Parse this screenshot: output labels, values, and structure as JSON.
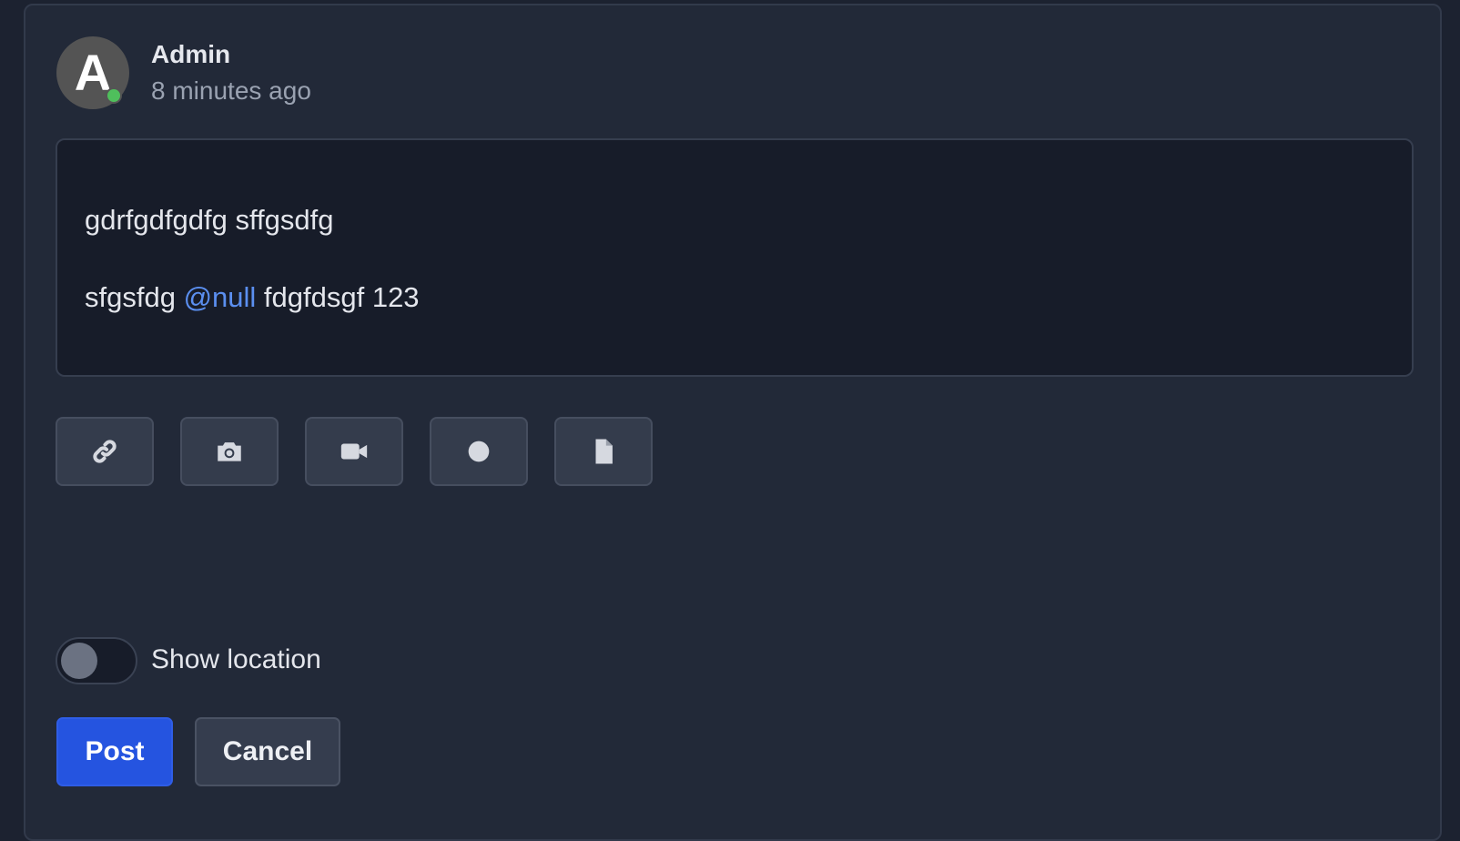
{
  "post": {
    "author": "Admin",
    "avatar_letter": "A",
    "timestamp": "8 minutes ago",
    "status": "online"
  },
  "editor": {
    "line1": "gdrfgdfgdfg sffgsdfg",
    "line2_before": "sfgsfdg ",
    "line2_mention": "@null",
    "line2_after": " fdgfdsgf 123"
  },
  "attachments": {
    "icons": [
      "link-icon",
      "camera-icon",
      "video-icon",
      "record-icon",
      "file-icon"
    ]
  },
  "location_toggle": {
    "label": "Show location",
    "enabled": false
  },
  "actions": {
    "post_label": "Post",
    "cancel_label": "Cancel"
  },
  "colors": {
    "background": "#222938",
    "editor_background": "#171c29",
    "accent": "#2554e0",
    "mention": "#5b8ff0",
    "online": "#4fbf5c"
  }
}
